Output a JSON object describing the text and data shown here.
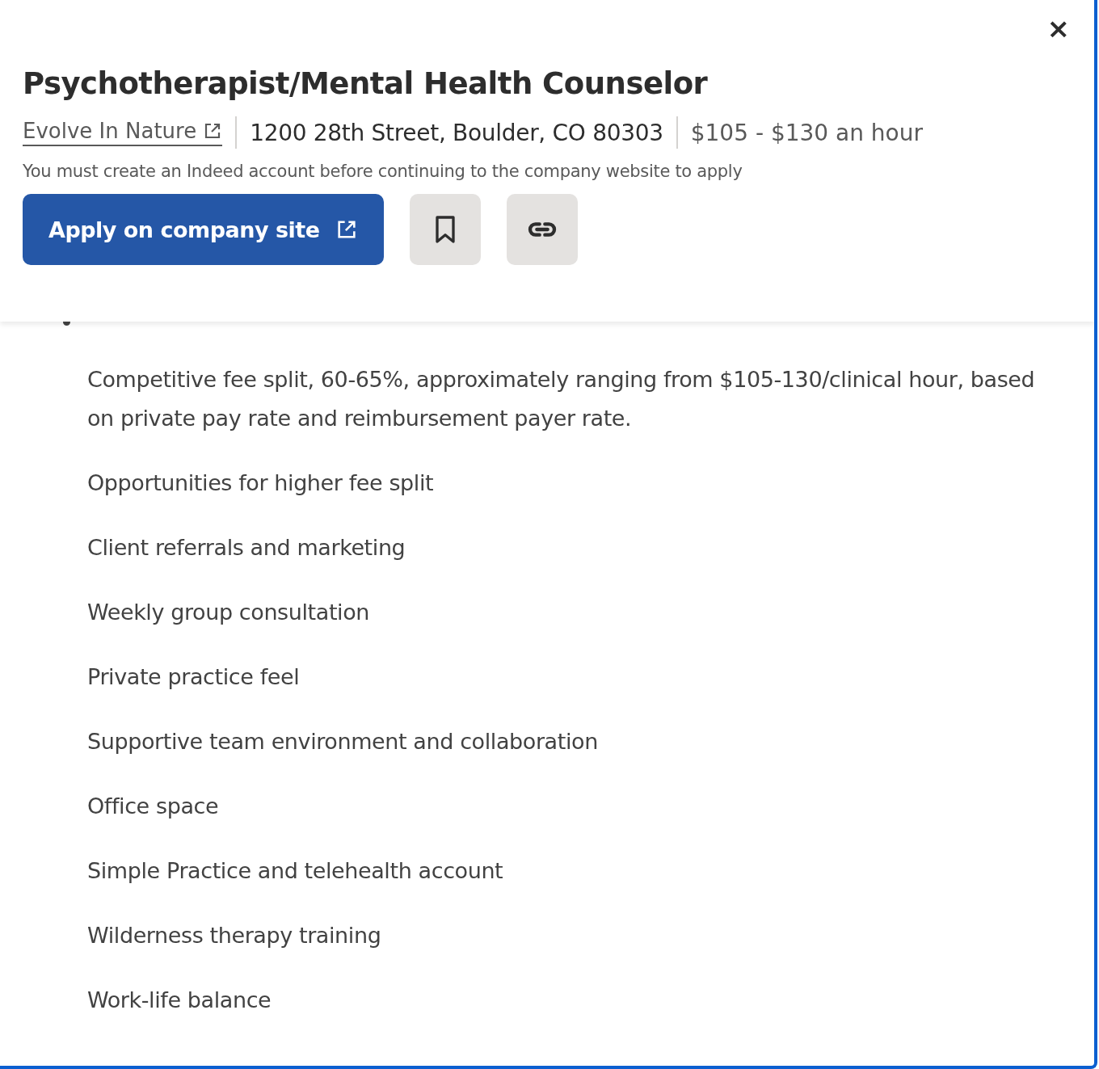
{
  "header": {
    "title": "Psychotherapist/Mental Health Counselor",
    "company": "Evolve In Nature",
    "location": "1200 28th Street, Boulder, CO 80303",
    "salary": "$105 - $130 an hour",
    "notice": "You must create an Indeed account before continuing to the company website to apply",
    "apply_button": "Apply on company site",
    "close": "×"
  },
  "section": {
    "items": [
      "Competitive fee split, 60-65%, approximately ranging from $105-130/clinical hour, based on private pay rate and reimbursement payer rate.",
      "Opportunities for higher fee split",
      "Client referrals and marketing",
      "Weekly group consultation",
      "Private practice feel",
      "Supportive team environment and collaboration",
      "Office space",
      "Simple Practice and telehealth account",
      "Wilderness therapy training",
      "Work-life balance"
    ]
  }
}
